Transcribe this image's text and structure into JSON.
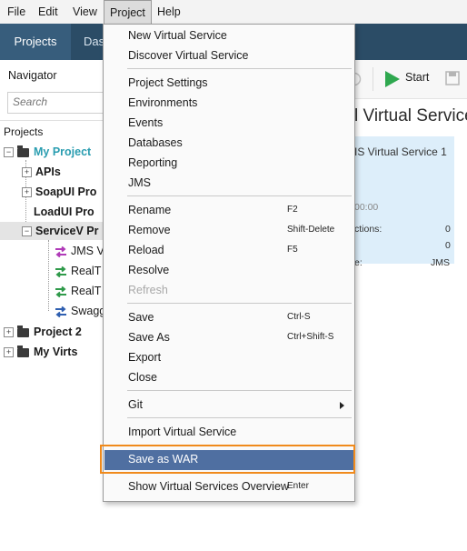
{
  "menubar": {
    "file": "File",
    "edit": "Edit",
    "view": "View",
    "project": "Project",
    "help": "Help"
  },
  "tabs": {
    "projects": "Projects",
    "das": "Das"
  },
  "navigator": {
    "title": "Navigator",
    "search_placeholder": "Search",
    "projects_label": "Projects",
    "tree": {
      "my_project": "My Project",
      "apis": "APIs",
      "soapui": "SoapUI Pro",
      "loadui": "LoadUI Pro",
      "servicev": "ServiceV Pr",
      "jms": "JMS V",
      "realt1": "RealT",
      "realt2": "RealT",
      "swagger": "Swagg",
      "project2": "Project 2",
      "my_virts": "My Virts"
    }
  },
  "right_panel": {
    "start": "Start",
    "title": "l Virtual Service",
    "card_title": "IS Virtual Service 1",
    "time": "00:00",
    "connections_label": "ctions:",
    "connections_value": "0",
    "row2_value": "0",
    "type_label": "e:",
    "type_value": "JMS"
  },
  "colors": {
    "accent": "#2b4c66",
    "menu_selected": "#4f6fa1",
    "highlight_border": "#f08a1c",
    "project_text": "#2a9db0"
  },
  "menu": {
    "new_virtual_service": "New Virtual Service",
    "discover_virtual_service": "Discover Virtual Service",
    "project_settings": "Project Settings",
    "environments": "Environments",
    "events": "Events",
    "databases": "Databases",
    "reporting": "Reporting",
    "jms": "JMS",
    "rename": "Rename",
    "rename_shortcut": "F2",
    "remove": "Remove",
    "remove_shortcut": "Shift-Delete",
    "reload": "Reload",
    "reload_shortcut": "F5",
    "resolve": "Resolve",
    "refresh": "Refresh",
    "save": "Save",
    "save_shortcut": "Ctrl-S",
    "save_as": "Save As",
    "save_as_shortcut": "Ctrl+Shift-S",
    "export": "Export",
    "close": "Close",
    "git": "Git",
    "import_virtual_service": "Import Virtual Service",
    "save_as_war": "Save as WAR",
    "show_overview": "Show Virtual Services Overview",
    "show_overview_shortcut": "Enter"
  }
}
